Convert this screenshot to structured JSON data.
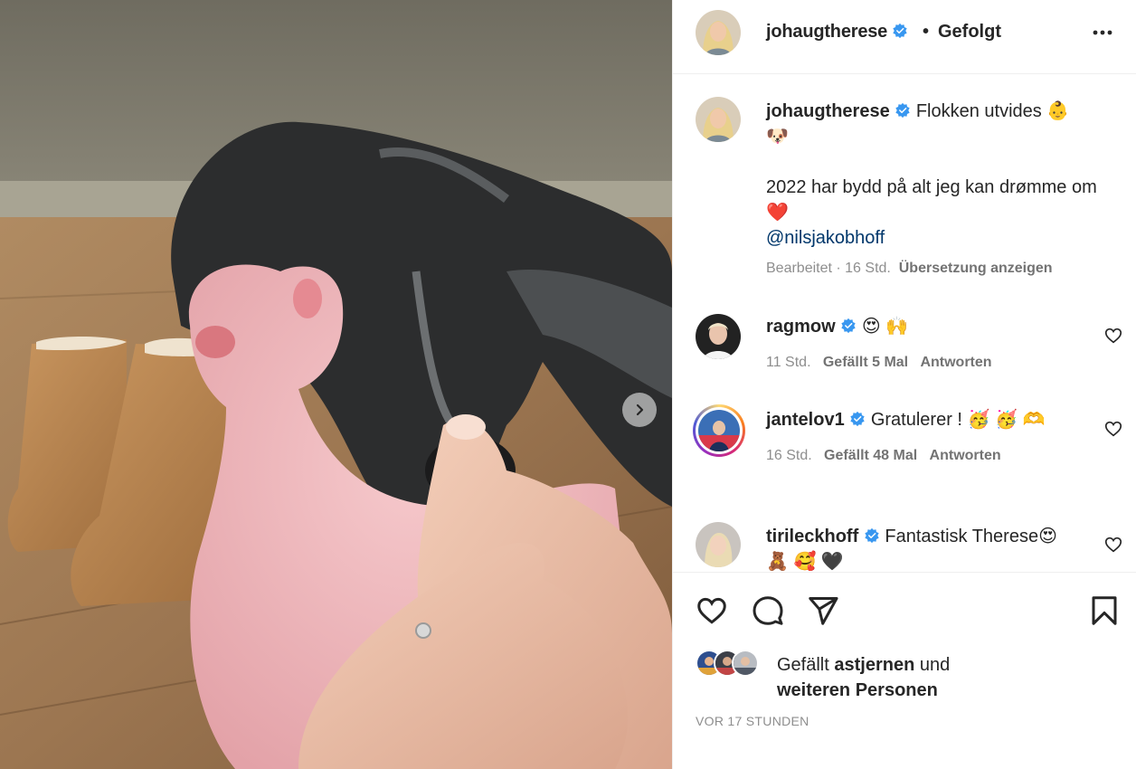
{
  "header": {
    "username": "johaugtherese",
    "separator": "•",
    "follow_status": "Gefolgt"
  },
  "caption": {
    "username": "johaugtherese",
    "line1": "Flokken utvides 👶",
    "line2": "🐶",
    "line3": "2022 har bydd på alt jeg kan drømme om❤️",
    "mention": "@nilsjakobhoff",
    "edited": "Bearbeitet · 16 Std.",
    "translate": "Übersetzung anzeigen"
  },
  "comments": [
    {
      "username": "ragmow",
      "text": "😍 🙌",
      "time": "11 Std.",
      "likes": "Gefällt 5 Mal",
      "reply": "Antworten"
    },
    {
      "username": "jantelov1",
      "text": "Gratulerer ! 🥳 🥳 🫶",
      "time": "16 Std.",
      "likes": "Gefällt 48 Mal",
      "reply": "Antworten"
    },
    {
      "username": "tirileckhoff",
      "text": "Fantastisk Therese😍",
      "text2": "🧸 🥰 🖤"
    }
  ],
  "likes": {
    "prefix": "Gefällt ",
    "user": "astjernen",
    "mid": " und",
    "others": "weiteren Personen"
  },
  "timestamp": "VOR 17 STUNDEN",
  "icons": {
    "verified": "verified-badge-icon",
    "next": "chevron-right-icon",
    "more": "more-horizontal-icon",
    "like": "heart-icon",
    "comment": "comment-bubble-icon",
    "share": "paper-plane-icon",
    "save": "bookmark-icon"
  },
  "colors": {
    "verified_blue": "#3897f0",
    "mention": "#00376b",
    "meta_gray": "#8e8e8e",
    "heart_red": "#ed4956"
  }
}
